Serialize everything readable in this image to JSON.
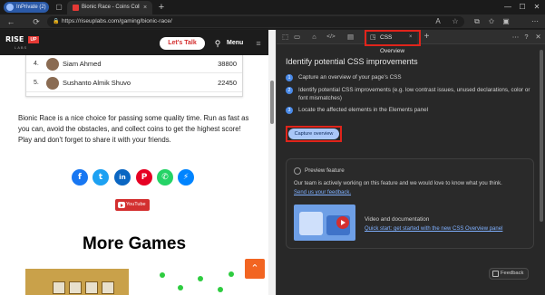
{
  "browser": {
    "profile_label": "InPrivate (2)",
    "tab_title": "Bionic Race - Coins Collecting G",
    "tab_close": "×",
    "new_tab": "+",
    "url": "https://riseuplabs.com/gaming/bionic-race/",
    "lock_glyph": "🔒",
    "window_controls": [
      "—",
      "☐",
      "✕"
    ]
  },
  "nav_icons": {
    "back": "←",
    "refresh": "⟳",
    "read_aloud": "A",
    "favorite": "☆",
    "collections": "⧉",
    "favorites_bar": "✩",
    "tabs": "▣",
    "more": "⋯"
  },
  "site": {
    "logo_rise": "RISE",
    "logo_up": "UP",
    "logo_labs": "LABS",
    "lets_talk": "Let's Talk",
    "search_glyph": "⚲",
    "menu_label": "Menu",
    "burger_glyph": "≡"
  },
  "leaderboard": [
    {
      "rank": "4.",
      "name": "Siam Ahmed",
      "score": "38800"
    },
    {
      "rank": "5.",
      "name": "Sushanto Almik Shuvo",
      "score": "22450"
    }
  ],
  "paragraph": "Bionic Race is a nice choice for passing some quality time. Run as fast as you can, avoid the obstacles, and collect coins to get the highest score! Play and don't forget to share it with your friends.",
  "social": [
    {
      "name": "facebook",
      "glyph": "f",
      "color": "#1877f2"
    },
    {
      "name": "twitter",
      "glyph": "t",
      "color": "#1da1f2"
    },
    {
      "name": "linkedin",
      "glyph": "in",
      "color": "#0a66c2"
    },
    {
      "name": "pinterest",
      "glyph": "P",
      "color": "#e60023"
    },
    {
      "name": "whatsapp",
      "glyph": "✆",
      "color": "#25d366"
    },
    {
      "name": "messenger",
      "glyph": "⚡",
      "color": "#0084ff"
    }
  ],
  "youtube_label": "YouTube",
  "more_games": "More Games",
  "scroll_top_glyph": "⌃",
  "devtools": {
    "toolbar_icons": [
      "⬚",
      "▭",
      "⌂",
      "</>",
      "▤"
    ],
    "active_tab": "CSS Overview",
    "active_tab_glyph": "◳",
    "tab_close": "×",
    "add_tab": "+",
    "right_icons": [
      "⋯",
      "?",
      "✕"
    ],
    "heading": "Identify potential CSS improvements",
    "steps": [
      {
        "num": "1",
        "text": "Capture an overview of your page's CSS"
      },
      {
        "num": "2",
        "text": "Identify potential CSS improvements (e.g. low contrast issues, unused declarations, color or font mismatches)"
      },
      {
        "num": "3",
        "text": "Locate the affected elements in the Elements panel"
      }
    ],
    "capture_button": "Capture overview",
    "preview_title": "Preview feature",
    "preview_text": "Our team is actively working on this feature and we would love to know what you think.",
    "preview_link": "Send us your feedback.",
    "video_label": "Video and documentation",
    "video_link": "Quick start: get started with the new CSS Overview panel",
    "feedback": "Feedback"
  },
  "colors": {
    "highlight_box": "#e0241b",
    "site_accent": "#d32f2f",
    "link": "#7fb0ff"
  }
}
